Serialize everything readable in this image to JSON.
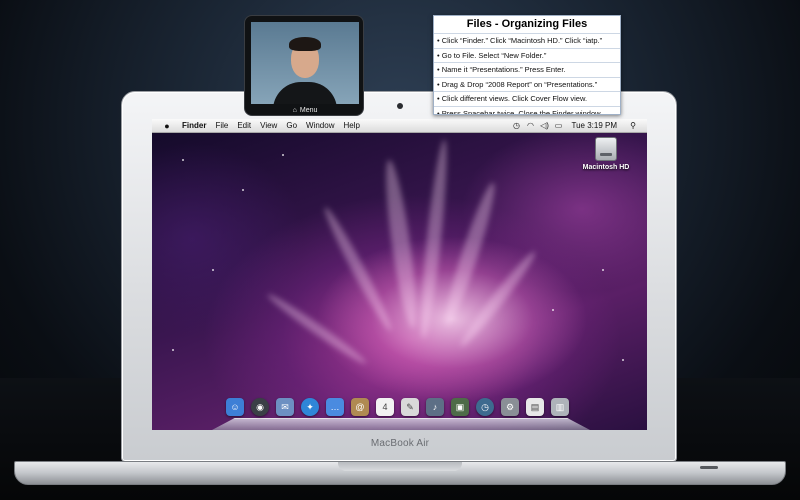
{
  "video": {
    "menu_label": "Menu",
    "icon": "home-icon"
  },
  "panel": {
    "title": "Files - Organizing Files",
    "steps": [
      "• Click “Finder.” Click “Macintosh HD.” Click “iatp.”",
      "• Go to File. Select “New Folder.”",
      "• Name it “Presentations.” Press Enter.",
      "• Drag & Drop “2008 Report” on “Presentations.”",
      "• Click different views. Click Cover Flow view.",
      "• Press Spacebar twice. Close the Finder window."
    ]
  },
  "menubar": {
    "apple_icon": "apple-icon",
    "app_name": "Finder",
    "items": [
      "File",
      "Edit",
      "View",
      "Go",
      "Window",
      "Help"
    ],
    "status_icons": [
      "time-machine-icon",
      "wifi-icon",
      "volume-icon",
      "battery-icon"
    ],
    "clock": "Tue 3:19 PM",
    "search_icon": "spotlight-icon"
  },
  "desktop": {
    "drive_label": "Macintosh HD"
  },
  "dock": {
    "items": [
      {
        "name": "finder-icon",
        "glyph": "☺",
        "color": "#3d7fd6"
      },
      {
        "name": "dashboard-icon",
        "glyph": "◉",
        "color": "#3a3f46"
      },
      {
        "name": "mail-icon",
        "glyph": "✉",
        "color": "#6d90c2"
      },
      {
        "name": "safari-icon",
        "glyph": "✦",
        "color": "#2f86d8"
      },
      {
        "name": "ichat-icon",
        "glyph": "…",
        "color": "#4a8be0"
      },
      {
        "name": "address-book-icon",
        "glyph": "@",
        "color": "#b08a52"
      },
      {
        "name": "ical-icon",
        "glyph": "4",
        "color": "#f2f2f2"
      },
      {
        "name": "preview-icon",
        "glyph": "✎",
        "color": "#d9d9d9"
      },
      {
        "name": "itunes-icon",
        "glyph": "♪",
        "color": "#5d6f86"
      },
      {
        "name": "iphoto-icon",
        "glyph": "▣",
        "color": "#4e6b48"
      },
      {
        "name": "time-machine-icon",
        "glyph": "◷",
        "color": "#3d6b8f"
      },
      {
        "name": "system-preferences-icon",
        "glyph": "⚙",
        "color": "#8a8f96"
      },
      {
        "name": "documents-icon",
        "glyph": "▤",
        "color": "#e8e8e8"
      },
      {
        "name": "trash-icon",
        "glyph": "▥",
        "color": "#aeb3b9"
      }
    ]
  },
  "laptop": {
    "model": "MacBook Air"
  }
}
